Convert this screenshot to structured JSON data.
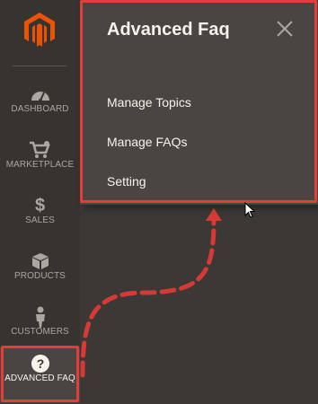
{
  "sidebar": {
    "items": [
      {
        "label": "DASHBOARD",
        "icon": "dashboard-icon"
      },
      {
        "label": "MARKETPLACE",
        "icon": "marketplace-icon"
      },
      {
        "label": "SALES",
        "icon": "dollar-icon"
      },
      {
        "label": "PRODUCTS",
        "icon": "box-icon"
      },
      {
        "label": "CUSTOMERS",
        "icon": "person-icon"
      },
      {
        "label": "ADVANCED FAQ",
        "icon": "question-icon"
      }
    ]
  },
  "panel": {
    "title": "Advanced Faq",
    "links": [
      "Manage Topics",
      "Manage FAQs",
      "Setting"
    ]
  },
  "colors": {
    "brand": "#eb5202",
    "highlight": "#e1403a",
    "sidebar_bg": "#373331",
    "panel_bg": "#4a4542"
  }
}
